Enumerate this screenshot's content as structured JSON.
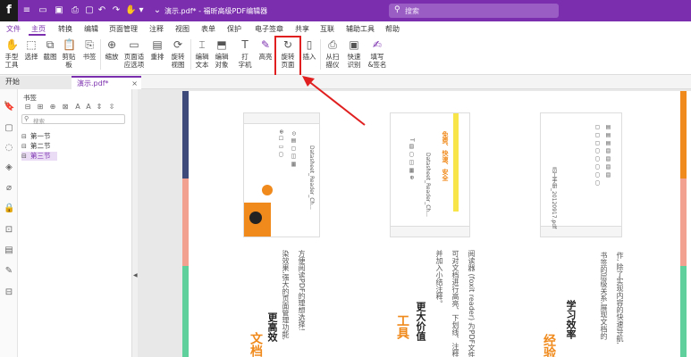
{
  "titlebar": {
    "logo": "f",
    "tab_title": "演示.pdf*",
    "app_name": "- 福昕高级PDF编辑器",
    "search_placeholder": "搜索"
  },
  "menu": [
    "文件",
    "主页",
    "转换",
    "编辑",
    "页面管理",
    "注释",
    "视图",
    "表单",
    "保护",
    "电子签章",
    "共享",
    "互联",
    "辅助工具",
    "帮助"
  ],
  "ribbon": [
    {
      "label": "手型\n工具",
      "icon": "hand-icon"
    },
    {
      "label": "选择",
      "icon": "cursor-icon"
    },
    {
      "label": "截图",
      "icon": "screenshot-icon"
    },
    {
      "label": "剪贴\n板",
      "icon": "clipboard-icon"
    },
    {
      "label": "书签",
      "icon": "bookmark-icon"
    },
    {
      "label": "缩放",
      "icon": "zoom-icon"
    },
    {
      "label": "页面适\n应选项",
      "icon": "fit-page-icon"
    },
    {
      "label": "重排",
      "icon": "reflow-icon"
    },
    {
      "label": "旋转\n视图",
      "icon": "rotate-view-icon"
    },
    {
      "label": "编辑\n文本",
      "icon": "edit-text-icon"
    },
    {
      "label": "编辑\n对象",
      "icon": "edit-object-icon"
    },
    {
      "label": "打\n字机",
      "icon": "typewriter-icon"
    },
    {
      "label": "高亮",
      "icon": "highlight-icon"
    },
    {
      "label": "旋转\n页面",
      "icon": "rotate-page-icon"
    },
    {
      "label": "插入",
      "icon": "insert-icon"
    },
    {
      "label": "从扫\n描仪",
      "icon": "scanner-icon"
    },
    {
      "label": "快速\n识别",
      "icon": "ocr-icon"
    },
    {
      "label": "填写\n&签名",
      "icon": "sign-icon"
    }
  ],
  "tabs": {
    "start": "开始",
    "doc": "演示.pdf*"
  },
  "bookmarks": {
    "title": "书签",
    "search_placeholder": "搜索",
    "items": [
      "第一节",
      "第二节",
      "第三节"
    ]
  },
  "doc": {
    "col1_body1": "方便阅读PDF的理想选择!",
    "col1_body2": "染效果,强大的页面管理功能,",
    "col1_head": "更高效",
    "col1_orange": "文档",
    "col2_head": "更大价值",
    "col2_orange": "工具",
    "col2_body1": "阅读器 (foxit reader) 为PDF文件添",
    "col2_body2": "可对文档进行高亮、下划线、注释、文",
    "col2_body3": "并加入小结注释。",
    "col3_head": "学习效率",
    "col3_orange": "经验",
    "col3_body1": "作, 除了实现内容的快速导航,",
    "col3_body2": "书签的层级关系,展现文档的",
    "thumb1_file": "Datasheet_Reader_Ch...",
    "thumb2_file": "Datasheet_Reader_Ch...",
    "thumb3_file": "员工手册_20120917.pdf",
    "thumb2_hl": "免费、快速、安全"
  },
  "colors": {
    "accent": "#7b2fae",
    "orange": "#f08a1c",
    "strip_navy": "#3e4a7a",
    "strip_salmon": "#f2a08f",
    "strip_green": "#5fcf9b",
    "callout": "#e02020"
  }
}
